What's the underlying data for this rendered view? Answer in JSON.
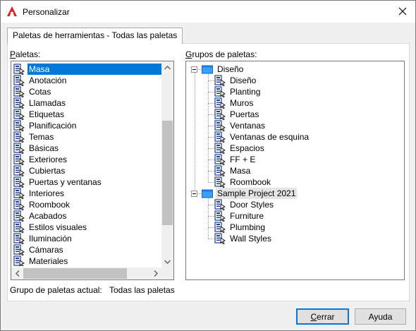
{
  "window": {
    "title": "Personalizar"
  },
  "tab": {
    "label": "Paletas de herramientas - Todas las paletas"
  },
  "palettes": {
    "label_prefix": "P",
    "label_rest": "aletas:",
    "selected_index": 0,
    "items": [
      "Masa",
      "Anotación",
      "Cotas",
      "Llamadas",
      "Etiquetas",
      "Planificación",
      "Temas",
      "Básicas",
      "Exteriores",
      "Cubiertas",
      "Puertas y ventanas",
      "Interiores",
      "Roombook",
      "Acabados",
      "Estilos visuales",
      "Iluminación",
      "Cámaras",
      "Materiales"
    ]
  },
  "groups": {
    "label_prefix": "G",
    "label_rest": "rupos de paletas:",
    "tree": [
      {
        "name": "Diseño",
        "children": [
          "Diseño",
          "Planting",
          "Muros",
          "Puertas",
          "Ventanas",
          "Ventanas de esquina",
          "Espacios",
          "FF + E",
          "Masa",
          "Roombook"
        ]
      },
      {
        "name": "Sample Project 2021",
        "children": [
          "Door Styles",
          "Furniture",
          "Plumbing",
          "Wall Styles"
        ]
      }
    ]
  },
  "current_group": {
    "label": "Grupo de paletas actual:",
    "value": "Todas las paletas"
  },
  "buttons": {
    "close_prefix": "C",
    "close_rest": "errar",
    "help": "Ayuda"
  },
  "colors": {
    "accent": "#0078d7",
    "autodesk_red": "#e51c23",
    "palette_icon_blue": "#1f3f8f"
  }
}
